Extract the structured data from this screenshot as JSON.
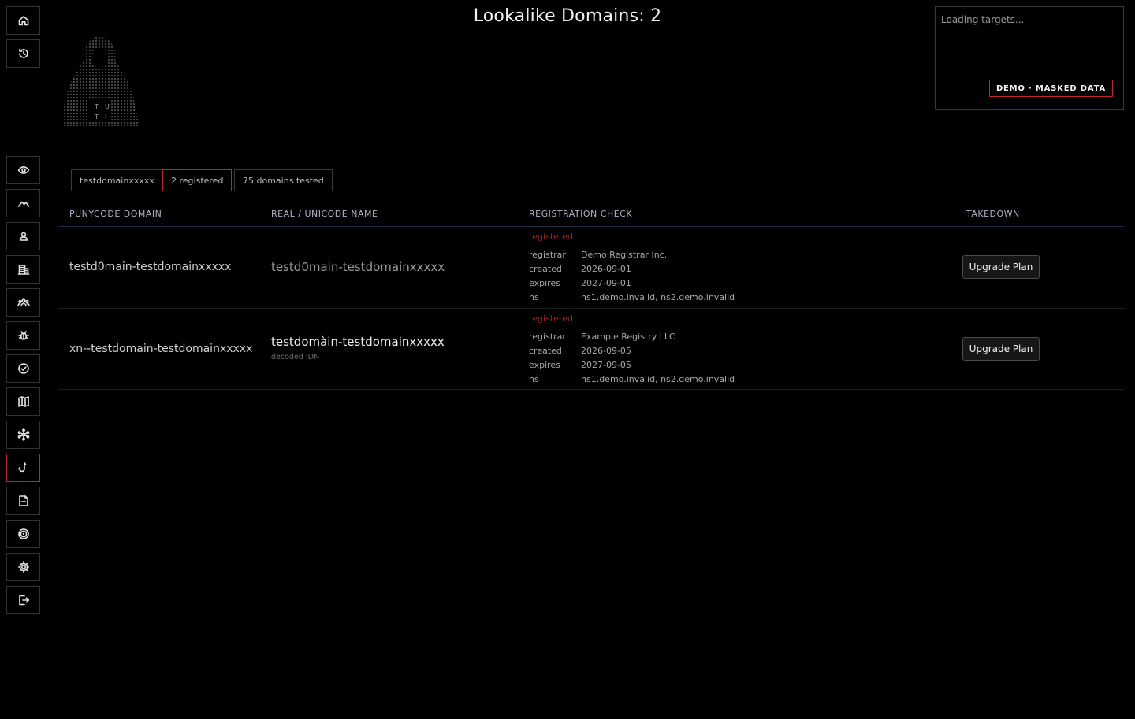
{
  "page": {
    "title": "Lookalike Domains: 2"
  },
  "logo": {
    "letters": [
      "T",
      "U",
      "T",
      "I"
    ]
  },
  "sidebar": {
    "top_items": [
      {
        "icon": "home-icon"
      },
      {
        "icon": "history-icon"
      }
    ],
    "items": [
      {
        "icon": "eye-icon"
      },
      {
        "icon": "mountain-icon"
      },
      {
        "icon": "user-icon"
      },
      {
        "icon": "building-icon"
      },
      {
        "icon": "users-group-icon"
      },
      {
        "icon": "bug-icon"
      },
      {
        "icon": "badge-check-icon"
      },
      {
        "icon": "map-icon"
      },
      {
        "icon": "network-icon"
      },
      {
        "icon": "phishing-hook-icon",
        "active": true
      },
      {
        "icon": "document-icon"
      },
      {
        "icon": "target-icon"
      },
      {
        "icon": "gear-icon"
      },
      {
        "icon": "logout-icon"
      }
    ]
  },
  "targets": {
    "loading_text": "Loading targets...",
    "demo_badge": "DEMO · MASKED DATA"
  },
  "chips": {
    "domain": "testdomainxxxxx",
    "registered": "2 registered",
    "tested": "75 domains tested"
  },
  "table": {
    "headers": {
      "punycode": "PUNYCODE DOMAIN",
      "real": "REAL / UNICODE NAME",
      "check": "REGISTRATION CHECK",
      "takedown": "TAKEDOWN"
    },
    "rows": [
      {
        "punycode": "testd0main-testdomainxxxxx",
        "real": "testd0main-testdomainxxxxx",
        "idn_note": "",
        "status": "registered",
        "registrar_label": "registrar",
        "registrar": "Demo Registrar Inc.",
        "created_label": "created",
        "created": "2026-09-01",
        "expires_label": "expires",
        "expires": "2027-09-01",
        "ns_label": "ns",
        "ns": "ns1.demo.invalid, ns2.demo.invalid",
        "action": "Upgrade Plan"
      },
      {
        "punycode": "xn--testdomain-testdomainxxxxx",
        "real": "testdomàin-testdomainxxxxx",
        "idn_note": "decoded IDN",
        "status": "registered",
        "registrar_label": "registrar",
        "registrar": "Example Registry LLC",
        "created_label": "created",
        "created": "2026-09-05",
        "expires_label": "expires",
        "expires": "2027-09-05",
        "ns_label": "ns",
        "ns": "ns1.demo.invalid, ns2.demo.invalid",
        "action": "Upgrade Plan"
      }
    ]
  },
  "colors": {
    "accent_red": "#c0232b",
    "background": "#000000"
  }
}
